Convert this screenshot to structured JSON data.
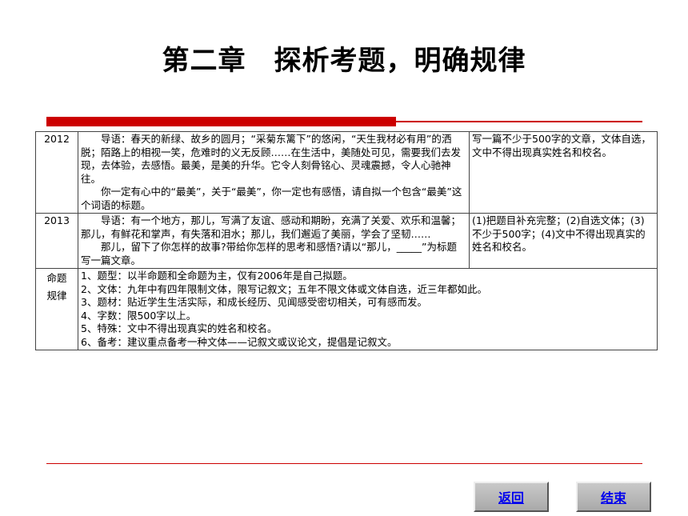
{
  "title": "第二章　探析考题，明确规律",
  "table": {
    "rows": [
      {
        "year": "2012",
        "prompt_lines": [
          "导语：春天的新绿、故乡的圆月；“采菊东篱下”的悠闲，“天生我材必有用”的洒脱；陌路上的相视一笑，危难时的义无反顾……在生活中，美随处可见，需要我们去发现，去体验，去感悟。最美，是美的升华。它令人刻骨铭心、灵魂震撼，令人心驰神往。",
          "你一定有心中的“最美”，关于“最美”，你一定也有感悟，请自拟一个包含“最美”这个词语的标题。"
        ],
        "requirement": "写一篇不少于500字的文章，文体自选，文中不得出现真实姓名和校名。"
      },
      {
        "year": "2013",
        "prompt_lines": [
          "导语：有一个地方，那儿，写满了友谊、感动和期盼，充满了关爱、欢乐和温馨；那儿，有鲜花和掌声，有失落和泪水；那儿，我们邂逅了美丽，学会了坚韧……",
          "那儿，留下了你怎样的故事?带给你怎样的思考和感悟?请以“那儿，_____”为标题写一篇文章。"
        ],
        "requirement": "(1)把题目补充完整；(2)自选文体；(3)不少于500字；(4)文中不得出现真实的姓名和校名。"
      }
    ],
    "rules": {
      "label_line1": "命题",
      "label_line2": "规律",
      "items": [
        "1、题型：以半命题和全命题为主，仅有2006年是自己拟题。",
        "2、文体：九年中有四年限制文体，限写记叙文；五年不限文体或文体自选，近三年都如此。",
        "3、题材：贴近学生生活实际，和成长经历、见闻感受密切相关，可有感而发。",
        "4、字数：限500字以上。",
        "5、特殊：文中不得出现真实的姓名和校名。",
        "6、备考：建议重点备考一种文体——记叙文或议论文，提倡是记叙文。"
      ]
    }
  },
  "buttons": {
    "back": "返回",
    "end": "结束"
  },
  "colors": {
    "accent_red": "#cc0000",
    "link_blue": "#0000ee",
    "button_gray": "#b8b8b8"
  }
}
